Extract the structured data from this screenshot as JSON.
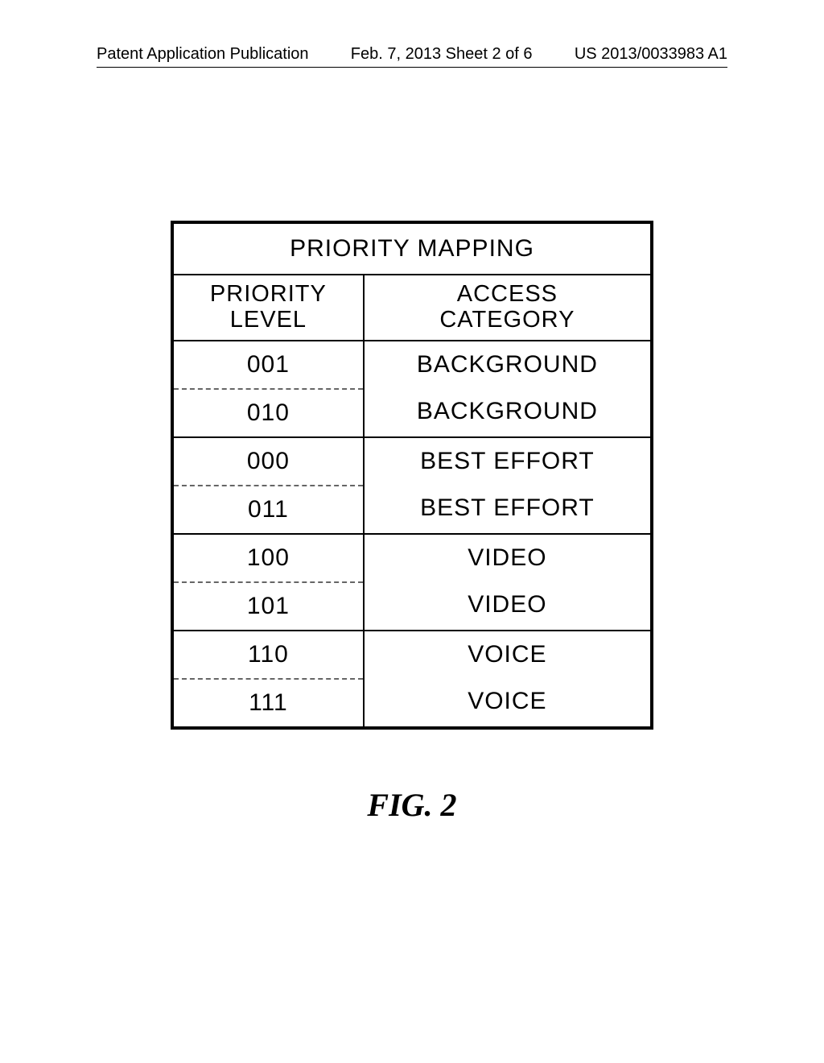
{
  "header": {
    "left": "Patent Application Publication",
    "center": "Feb. 7, 2013  Sheet 2 of 6",
    "right": "US 2013/0033983 A1"
  },
  "table": {
    "title": "PRIORITY MAPPING",
    "col1_header_line1": "PRIORITY",
    "col1_header_line2": "LEVEL",
    "col2_header_line1": "ACCESS",
    "col2_header_line2": "CATEGORY",
    "groups": [
      {
        "p1": "001",
        "p2": "010",
        "a1": "BACKGROUND",
        "a2": "BACKGROUND"
      },
      {
        "p1": "000",
        "p2": "011",
        "a1": "BEST EFFORT",
        "a2": "BEST EFFORT"
      },
      {
        "p1": "100",
        "p2": "101",
        "a1": "VIDEO",
        "a2": "VIDEO"
      },
      {
        "p1": "110",
        "p2": "111",
        "a1": "VOICE",
        "a2": "VOICE"
      }
    ]
  },
  "figure_caption": "FIG. 2",
  "chart_data": {
    "type": "table",
    "title": "PRIORITY MAPPING",
    "columns": [
      "PRIORITY LEVEL",
      "ACCESS CATEGORY"
    ],
    "rows": [
      [
        "001",
        "BACKGROUND"
      ],
      [
        "010",
        "BACKGROUND"
      ],
      [
        "000",
        "BEST EFFORT"
      ],
      [
        "011",
        "BEST EFFORT"
      ],
      [
        "100",
        "VIDEO"
      ],
      [
        "101",
        "VIDEO"
      ],
      [
        "110",
        "VOICE"
      ],
      [
        "111",
        "VOICE"
      ]
    ]
  }
}
